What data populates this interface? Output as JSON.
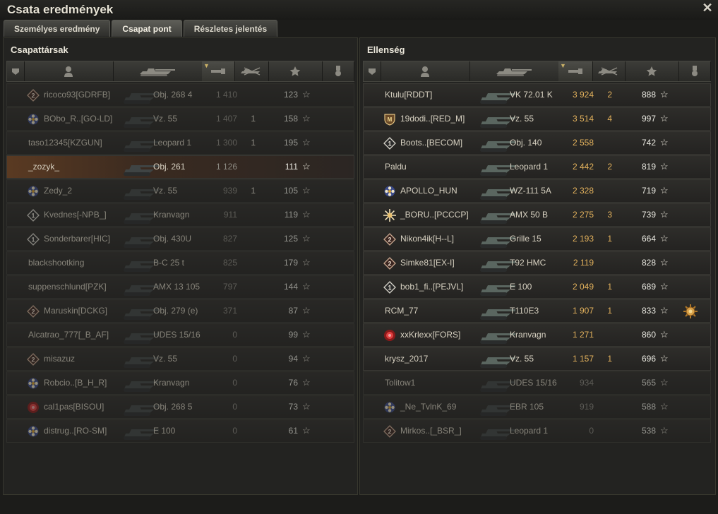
{
  "window": {
    "title": "Csata eredmények"
  },
  "tabs": [
    {
      "label": "Személyes eredmény",
      "active": false
    },
    {
      "label": "Csapat pont",
      "active": true
    },
    {
      "label": "Részletes jelentés",
      "active": false
    }
  ],
  "columns": [
    "platoon-icon",
    "player-icon",
    "vehicle-icon",
    "damage-icon",
    "kills-icon",
    "xp-star-icon",
    "medal-icon"
  ],
  "left": {
    "title": "Csapattársak",
    "rows": [
      {
        "badge": "rank2",
        "name": "ricoco93[GDRFB]",
        "vehicle": "Obj. 268 4",
        "damage": "1 410",
        "kills": "",
        "xp": "123",
        "dead": true
      },
      {
        "badge": "flower",
        "name": "BObo_R..[GO-LD]",
        "vehicle": "Vz. 55",
        "damage": "1 407",
        "kills": "1",
        "xp": "158",
        "dead": true
      },
      {
        "badge": "",
        "name": "taso12345[KZGUN]",
        "vehicle": "Leopard 1",
        "damage": "1 300",
        "kills": "1",
        "xp": "195",
        "dead": true
      },
      {
        "badge": "",
        "name": "_zozyk_",
        "vehicle": "Obj. 261",
        "damage": "1 126",
        "kills": "",
        "xp": "111",
        "dead": true,
        "me": true
      },
      {
        "badge": "flower",
        "name": "Zedy_2",
        "vehicle": "Vz. 55",
        "damage": "939",
        "kills": "1",
        "xp": "105",
        "dead": true
      },
      {
        "badge": "rank1",
        "name": "Kvednes[-NPB_]",
        "vehicle": "Kranvagn",
        "damage": "911",
        "kills": "",
        "xp": "119",
        "dead": true
      },
      {
        "badge": "rank1",
        "name": "Sonderbarer[HIC]",
        "vehicle": "Obj. 430U",
        "damage": "827",
        "kills": "",
        "xp": "125",
        "dead": true
      },
      {
        "badge": "",
        "name": "blackshootking",
        "vehicle": "B-C 25 t",
        "damage": "825",
        "kills": "",
        "xp": "179",
        "dead": true
      },
      {
        "badge": "",
        "name": "suppenschlund[PZK]",
        "vehicle": "AMX 13 105",
        "damage": "797",
        "kills": "",
        "xp": "144",
        "dead": true
      },
      {
        "badge": "rank2",
        "name": "Maruskin[DCKG]",
        "vehicle": "Obj. 279 (e)",
        "damage": "371",
        "kills": "",
        "xp": "87",
        "dead": true
      },
      {
        "badge": "",
        "name": "Alcatrao_777[_B_AF]",
        "vehicle": "UDES 15/16",
        "damage": "0",
        "kills": "",
        "xp": "99",
        "dead": true
      },
      {
        "badge": "rank2",
        "name": "misazuz",
        "vehicle": "Vz. 55",
        "damage": "0",
        "kills": "",
        "xp": "94",
        "dead": true
      },
      {
        "badge": "flower",
        "name": "Robcio..[B_H_R]",
        "vehicle": "Kranvagn",
        "damage": "0",
        "kills": "",
        "xp": "76",
        "dead": true
      },
      {
        "badge": "red",
        "name": "cal1pas[BISOU]",
        "vehicle": "Obj. 268 5",
        "damage": "0",
        "kills": "",
        "xp": "73",
        "dead": true
      },
      {
        "badge": "flower",
        "name": "distrug..[RO-SM]",
        "vehicle": "E 100",
        "damage": "0",
        "kills": "",
        "xp": "61",
        "dead": true
      }
    ]
  },
  "right": {
    "title": "Ellenség",
    "rows": [
      {
        "badge": "",
        "name": "Ktulu[RDDT]",
        "vehicle": "VK 72.01 K",
        "damage": "3 924",
        "kills": "2",
        "xp": "888",
        "dead": false
      },
      {
        "badge": "shield",
        "name": "19dodi..[RED_M]",
        "vehicle": "Vz. 55",
        "damage": "3 514",
        "kills": "4",
        "xp": "997",
        "dead": false
      },
      {
        "badge": "rank1",
        "name": "Boots..[BECOM]",
        "vehicle": "Obj. 140",
        "damage": "2 558",
        "kills": "",
        "xp": "742",
        "dead": false
      },
      {
        "badge": "",
        "name": "Paldu",
        "vehicle": "Leopard 1",
        "damage": "2 442",
        "kills": "2",
        "xp": "819",
        "dead": false
      },
      {
        "badge": "flower",
        "name": "APOLLO_HUN",
        "vehicle": "WZ-111 5A",
        "damage": "2 328",
        "kills": "",
        "xp": "719",
        "dead": false
      },
      {
        "badge": "sun",
        "name": "_BORU..[PCCCP]",
        "vehicle": "AMX 50 B",
        "damage": "2 275",
        "kills": "3",
        "xp": "739",
        "dead": false
      },
      {
        "badge": "rank2",
        "name": "Nikon4ik[H--L]",
        "vehicle": "Grille 15",
        "damage": "2 193",
        "kills": "1",
        "xp": "664",
        "dead": false
      },
      {
        "badge": "rank2",
        "name": "Simke81[EX-I]",
        "vehicle": "T92 HMC",
        "damage": "2 119",
        "kills": "",
        "xp": "828",
        "dead": false
      },
      {
        "badge": "rank1",
        "name": "bob1_fi..[PEJVL]",
        "vehicle": "E 100",
        "damage": "2 049",
        "kills": "1",
        "xp": "689",
        "dead": false
      },
      {
        "badge": "",
        "name": "RCM_77",
        "vehicle": "T110E3",
        "damage": "1 907",
        "kills": "1",
        "xp": "833",
        "dead": false,
        "medal": true
      },
      {
        "badge": "red",
        "name": "xxKrlexx[FORS]",
        "vehicle": "Kranvagn",
        "damage": "1 271",
        "kills": "",
        "xp": "860",
        "dead": false
      },
      {
        "badge": "",
        "name": "krysz_2017",
        "vehicle": "Vz. 55",
        "damage": "1 157",
        "kills": "1",
        "xp": "696",
        "dead": false
      },
      {
        "badge": "",
        "name": "Tolitow1",
        "vehicle": "UDES 15/16",
        "damage": "934",
        "kills": "",
        "xp": "565",
        "dead": true
      },
      {
        "badge": "flower",
        "name": "_Ne_TvlnK_69",
        "vehicle": "EBR 105",
        "damage": "919",
        "kills": "",
        "xp": "588",
        "dead": true
      },
      {
        "badge": "rank2",
        "name": "Mirkos..[_BSR_]",
        "vehicle": "Leopard 1",
        "damage": "0",
        "kills": "",
        "xp": "538",
        "dead": true
      }
    ]
  }
}
